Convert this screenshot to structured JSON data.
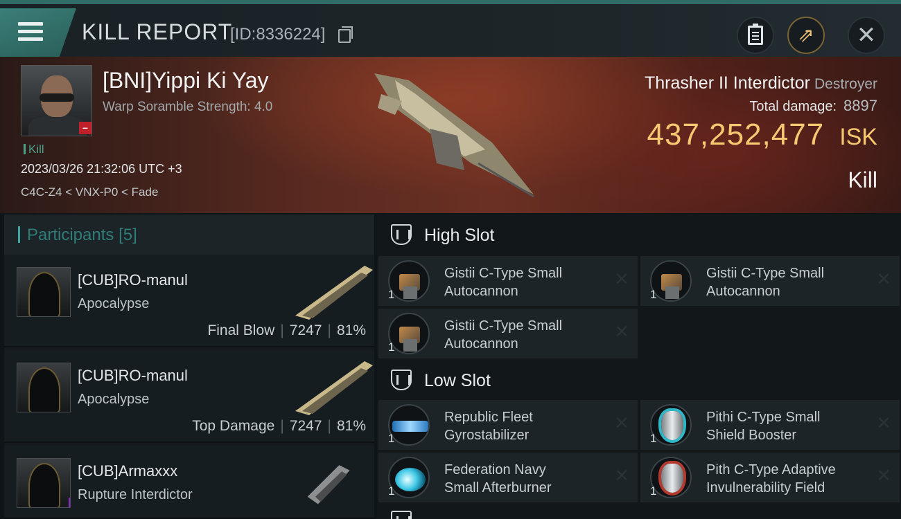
{
  "header": {
    "title": "KILL REPORT",
    "id_label": "[ID:8336224]"
  },
  "victim": {
    "name": "[BNI]Yippi Ki Yay",
    "attribute": "Warp Soramble Strength: 4.0",
    "tag": "Kill",
    "datetime": "2023/03/26 21:32:06 UTC +3",
    "location": "C4C-Z4 < VNX-P0 < Fade"
  },
  "ship": {
    "name": "Thrasher II Interdictor",
    "class": "Destroyer",
    "total_damage_label": "Total damage:",
    "total_damage": "8897",
    "isk_value": "437,252,477",
    "isk_unit": "ISK",
    "result": "Kill"
  },
  "participants": {
    "title": "Participants",
    "count": "[5]",
    "items": [
      {
        "name": "[CUB]RO-manul",
        "ship": "Apocalypse",
        "role": "Final Blow",
        "damage": "7247",
        "percent": "81%"
      },
      {
        "name": "[CUB]RO-manul",
        "ship": "Apocalypse",
        "role": "Top Damage",
        "damage": "7247",
        "percent": "81%"
      },
      {
        "name": "[CUB]Armaxxx",
        "ship": "Rupture Interdictor"
      }
    ]
  },
  "fitting": {
    "high_slot": {
      "title": "High Slot",
      "modules": [
        {
          "line1": "Gistii C-Type Small",
          "line2": "Autocannon",
          "qty": "1"
        },
        {
          "line1": "Gistii C-Type Small",
          "line2": "Autocannon",
          "qty": "1"
        },
        {
          "line1": "Gistii C-Type Small",
          "line2": "Autocannon",
          "qty": "1"
        }
      ]
    },
    "low_slot": {
      "title": "Low Slot",
      "modules": [
        {
          "line1": "Republic Fleet",
          "line2": "Gyrostabilizer",
          "qty": "1"
        },
        {
          "line1": "Pithi C-Type Small",
          "line2": "Shield Booster",
          "qty": "1"
        },
        {
          "line1": "Federation Navy",
          "line2": "Small Afterburner",
          "qty": "1"
        },
        {
          "line1": "Pith C-Type Adaptive",
          "line2": "Invulnerability Field",
          "qty": "1"
        }
      ]
    },
    "remove_symbol": "✕"
  },
  "colors": {
    "accent_teal": "#3aa7a0",
    "isk_gold": "#f6c872",
    "loss_red": "#c0202a"
  }
}
